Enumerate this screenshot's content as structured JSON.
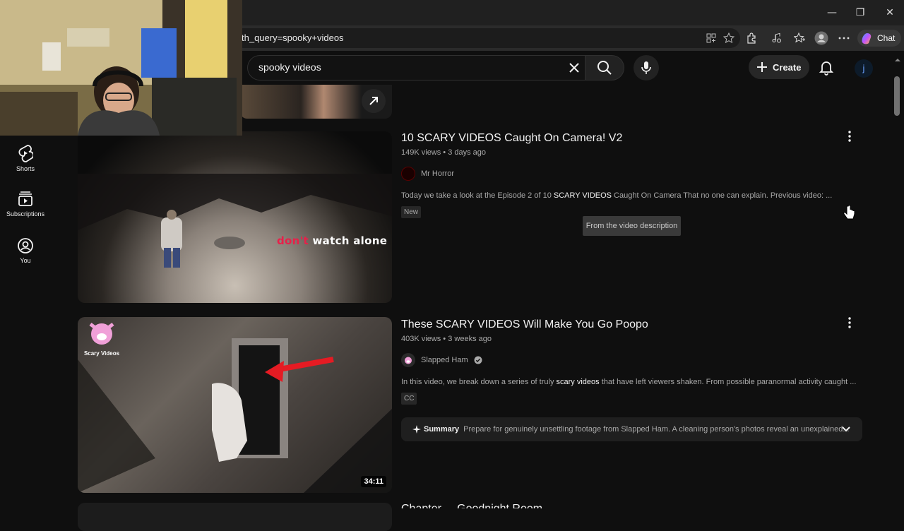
{
  "browser": {
    "url": "th_query=spooky+videos",
    "chat_label": "Chat",
    "window_controls": [
      "minimize",
      "maximize",
      "close"
    ]
  },
  "header": {
    "search_value": "spooky videos",
    "create_label": "Create",
    "avatar_letter": "j"
  },
  "sidebar": {
    "items": [
      {
        "label": "Shorts",
        "icon": "shorts-icon"
      },
      {
        "label": "Subscriptions",
        "icon": "subscriptions-icon"
      },
      {
        "label": "You",
        "icon": "you-icon"
      }
    ]
  },
  "results": [
    {
      "title": "10 SCARY VIDEOS Caught On Camera! V2",
      "meta": "149K views • 3 days ago",
      "channel": "Mr Horror",
      "verified": false,
      "desc_prefix": "Today we take a look at the Episode 2 of 10 ",
      "desc_bold": "SCARY VIDEOS",
      "desc_suffix": " Caught On Camera That no one can explain. Previous video: ...",
      "badge": "New",
      "thumb_caption_red": "don't",
      "thumb_caption_white": "watch alone"
    },
    {
      "title": "These SCARY VIDEOS Will Make You Go Poopo",
      "meta": "403K views • 3 weeks ago",
      "channel": "Slapped Ham",
      "verified": true,
      "desc_prefix": "In this video, we break down a series of truly ",
      "desc_bold": "scary videos",
      "desc_suffix": " that have left viewers shaken. From possible paranormal activity caught ...",
      "badge": "CC",
      "duration": "34:11",
      "thumb_logo_text": "Scary Videos",
      "summary_label": "Summary",
      "summary_text": "Prepare for genuinely unsettling footage from Slapped Ham. A cleaning person's photos reveal an unexplained..."
    },
    {
      "title": "Chapter ... Goodnight Room"
    }
  ],
  "tooltip": "From the video description"
}
